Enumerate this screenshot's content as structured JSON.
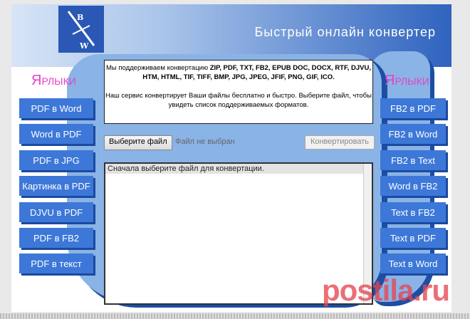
{
  "header": {
    "title": "Быстрый онлайн конвертер",
    "logo_letters": [
      "B",
      "W"
    ]
  },
  "left_sidebar": {
    "heading": "Ярлыки",
    "items": [
      "PDF в Word",
      "Word в PDF",
      "PDF в JPG",
      "Картинка в PDF",
      "DJVU в PDF",
      "PDF в FB2",
      "PDF в текст"
    ]
  },
  "right_sidebar": {
    "heading": "Ярлыки",
    "items": [
      "FB2 в PDF",
      "FB2 в Word",
      "FB2 в Text",
      "Word в FB2",
      "Text в FB2",
      "Text в PDF",
      "Text в Word"
    ]
  },
  "info": {
    "intro": "Мы поддерживаем конвертацию",
    "formats": "ZIP, PDF, TXT, FB2, EPUB DOC, DOCX, RTF, DJVU, HTM, HTML, TIF, TIFF, BMP, JPG, JPEG, JFIF, PNG, GIF, ICO.",
    "description": "Наш сервис конвертирует Ваши файлы бесплатно и быстро. Выберите файл, чтобы увидеть список поддерживаемых форматов."
  },
  "upload": {
    "choose_label": "Выберите файл",
    "no_file": "Файл не выбран",
    "convert_label": "Конвертировать"
  },
  "output": {
    "message": "Сначала выберите файл для конвертации."
  },
  "watermark": "postila.ru",
  "colors": {
    "nav_button": "#3d78d8",
    "heading": "#e83fc8",
    "panel": "#8ab3e6",
    "header_dark": "#2f63bf"
  }
}
